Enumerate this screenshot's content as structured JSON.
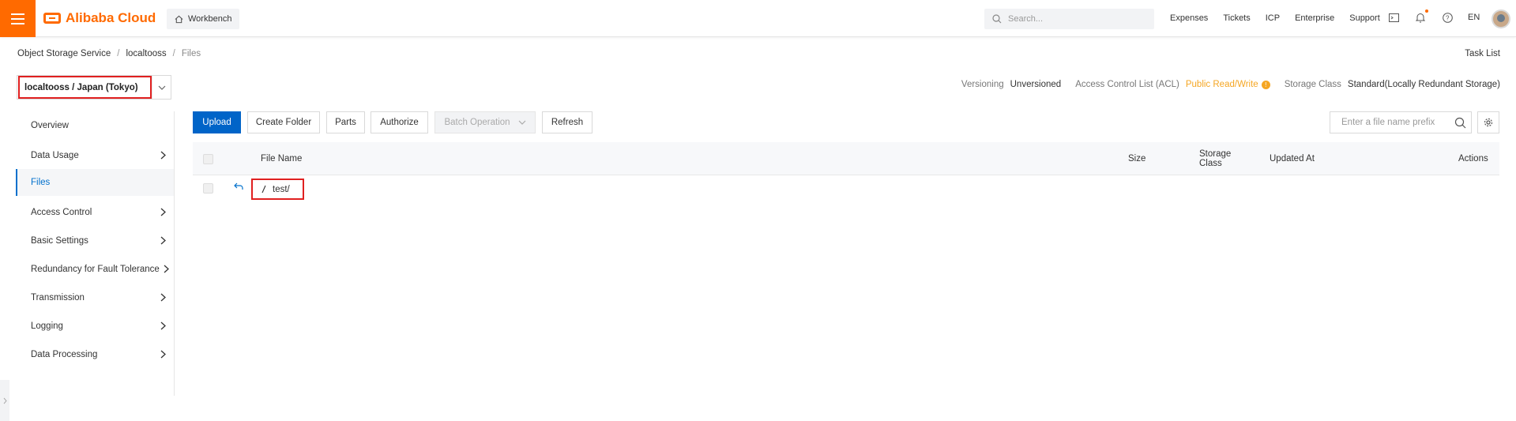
{
  "header": {
    "brand": "Alibaba Cloud",
    "workbench": "Workbench",
    "search_placeholder": "Search...",
    "nav": [
      "Expenses",
      "Tickets",
      "ICP",
      "Enterprise",
      "Support"
    ],
    "lang": "EN",
    "colors": {
      "accent": "#ff6a00",
      "primary": "#0064c8"
    }
  },
  "breadcrumb": [
    "Object Storage Service",
    "localtooss",
    "Files"
  ],
  "task_list": "Task List",
  "bucket": {
    "selector": "localtooss / Japan (Tokyo)"
  },
  "meta": {
    "versioning_label": "Versioning",
    "versioning_value": "Unversioned",
    "acl_label": "Access Control List (ACL)",
    "acl_value": "Public Read/Write",
    "storage_label": "Storage Class",
    "storage_value": "Standard(Locally Redundant Storage)"
  },
  "sidebar": {
    "items": [
      {
        "label": "Overview",
        "has_arrow": false
      },
      {
        "label": "Data Usage",
        "has_arrow": true
      },
      {
        "label": "Files",
        "has_arrow": false,
        "active": true
      },
      {
        "label": "Access Control",
        "has_arrow": true
      },
      {
        "label": "Basic Settings",
        "has_arrow": true
      },
      {
        "label": "Redundancy for Fault Tolerance",
        "has_arrow": true
      },
      {
        "label": "Transmission",
        "has_arrow": true
      },
      {
        "label": "Logging",
        "has_arrow": true
      },
      {
        "label": "Data Processing",
        "has_arrow": true
      }
    ]
  },
  "toolbar": {
    "upload": "Upload",
    "create_folder": "Create Folder",
    "parts": "Parts",
    "authorize": "Authorize",
    "batch_operation": "Batch Operation",
    "refresh": "Refresh",
    "prefix_placeholder": "Enter a file name prefix"
  },
  "table": {
    "columns": {
      "file_name": "File Name",
      "size": "Size",
      "storage_class": "Storage Class",
      "updated_at": "Updated At",
      "actions": "Actions"
    },
    "rows": [
      {
        "name": "test/"
      }
    ]
  }
}
